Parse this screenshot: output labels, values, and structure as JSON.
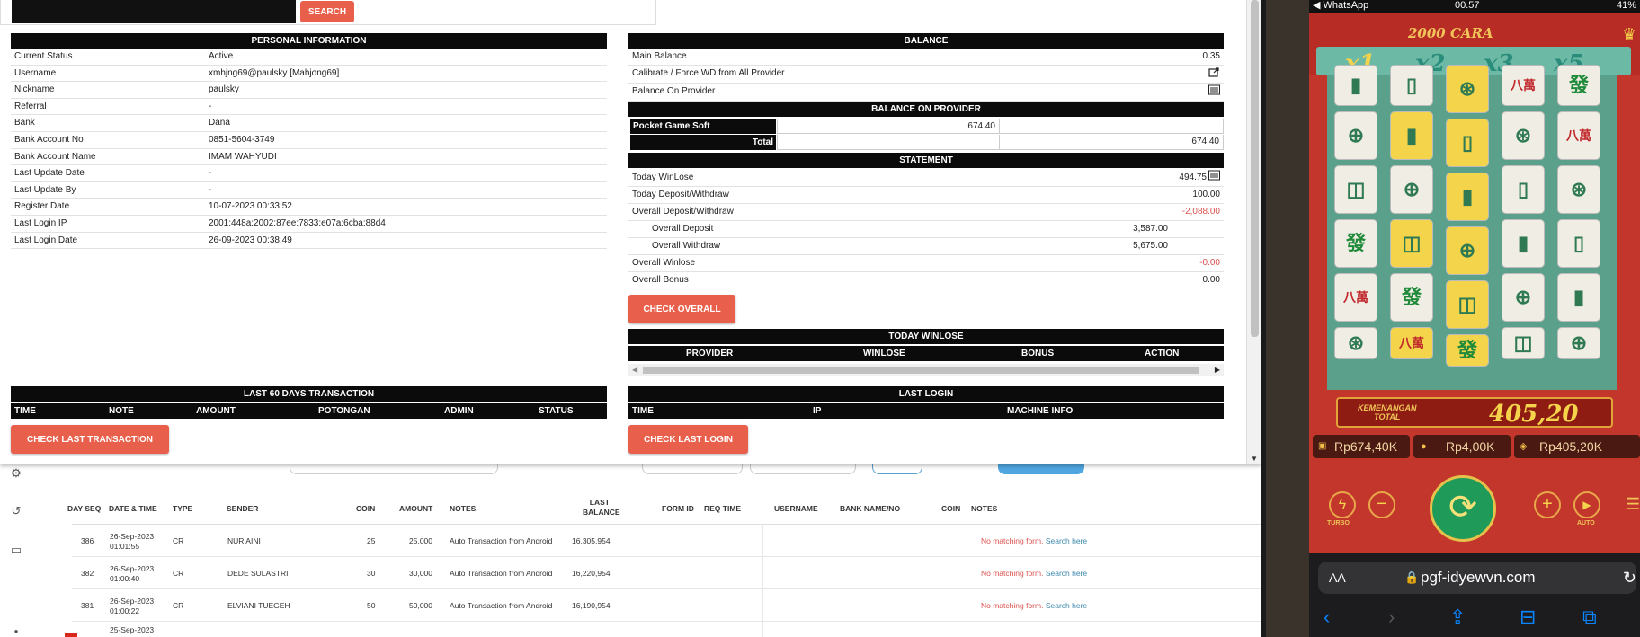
{
  "search": {
    "button_label": "SEARCH"
  },
  "personal": {
    "title": "PERSONAL INFORMATION",
    "rows": [
      {
        "label": "Current Status",
        "value": "Active"
      },
      {
        "label": "Username",
        "value": "xmhjng69@paulsky  [Mahjong69]"
      },
      {
        "label": "Nickname",
        "value": "paulsky"
      },
      {
        "label": "Referral",
        "value": "-"
      },
      {
        "label": "Bank",
        "value": "Dana"
      },
      {
        "label": "Bank Account No",
        "value": "0851-5604-3749"
      },
      {
        "label": "Bank Account Name",
        "value": "IMAM WAHYUDI"
      },
      {
        "label": "Last Update Date",
        "value": "-"
      },
      {
        "label": "Last Update By",
        "value": "-"
      },
      {
        "label": "Register Date",
        "value": "10-07-2023 00:33:52"
      },
      {
        "label": "Last Login IP",
        "value": "2001:448a:2002:87ee:7833:e07a:6cba:88d4"
      },
      {
        "label": "Last Login Date",
        "value": "26-09-2023 00:38:49"
      }
    ]
  },
  "balance": {
    "title": "BALANCE",
    "main_label": "Main Balance",
    "main_value": "0.35",
    "calibrate_label": "Calibrate / Force WD from All Provider",
    "on_provider_label": "Balance On Provider",
    "provider_title": "BALANCE ON PROVIDER",
    "provider_name": "Pocket Game Soft",
    "provider_value": "674.40",
    "total_label": "Total",
    "total_value": "674.40"
  },
  "statement": {
    "title": "STATEMENT",
    "today_winlose_label": "Today WinLose",
    "today_winlose_value": "494.75",
    "today_dw_label": "Today Deposit/Withdraw",
    "today_dw_value": "100.00",
    "overall_dw_label": "Overall Deposit/Withdraw",
    "overall_dw_value": "-2,088.00",
    "overall_deposit_label": "Overall Deposit",
    "overall_deposit_value": "3,587.00",
    "overall_withdraw_label": "Overall Withdraw",
    "overall_withdraw_value": "5,675.00",
    "overall_winlose_label": "Overall Winlose",
    "overall_winlose_value": "-0.00",
    "overall_bonus_label": "Overall Bonus",
    "overall_bonus_value": "0.00",
    "check_overall": "CHECK OVERALL"
  },
  "today_winlose": {
    "title": "TODAY WINLOSE",
    "columns": [
      "PROVIDER",
      "WINLOSE",
      "BONUS",
      "ACTION"
    ]
  },
  "last60": {
    "title": "LAST 60 DAYS TRANSACTION",
    "columns": [
      "TIME",
      "NOTE",
      "AMOUNT",
      "POTONGAN",
      "ADMIN",
      "STATUS"
    ],
    "button": "CHECK LAST TRANSACTION"
  },
  "last_login": {
    "title": "LAST LOGIN",
    "columns": [
      "TIME",
      "IP",
      "MACHINE INFO"
    ],
    "button": "CHECK LAST LOGIN"
  },
  "bg_table": {
    "headers": [
      "DAY SEQ",
      "DATE & TIME",
      "TYPE",
      "SENDER",
      "COIN",
      "AMOUNT",
      "NOTES",
      "LAST BALANCE",
      "FORM ID",
      "REQ TIME",
      "USERNAME",
      "BANK NAME/NO",
      "COIN",
      "NOTES"
    ],
    "rows": [
      {
        "seq": "386",
        "date": "26-Sep-2023 01:01:55",
        "type": "CR",
        "sender": "NUR AINI",
        "coin": "25",
        "amount": "25,000",
        "notes": "Auto Transaction from Android",
        "last": "16,305,954",
        "nomatch": "No matching form.",
        "search": "Search here"
      },
      {
        "seq": "382",
        "date": "26-Sep-2023 01:00:40",
        "type": "CR",
        "sender": "DEDE SULASTRI",
        "coin": "30",
        "amount": "30,000",
        "notes": "Auto Transaction from Android",
        "last": "16,220,954",
        "nomatch": "No matching form.",
        "search": "Search here"
      },
      {
        "seq": "381",
        "date": "26-Sep-2023 01:00:22",
        "type": "CR",
        "sender": "ELVIANI TUEGEH",
        "coin": "50",
        "amount": "50,000",
        "notes": "Auto Transaction from Android",
        "last": "16,190,954",
        "nomatch": "No matching form.",
        "search": "Search here"
      },
      {
        "seq": "",
        "date": "25-Sep-2023",
        "type": "",
        "sender": "",
        "coin": "",
        "amount": "",
        "notes": "",
        "last": "",
        "nomatch": "",
        "search": ""
      }
    ]
  },
  "phone": {
    "status_app": "◀ WhatsApp",
    "status_time": "00.57",
    "status_batt": "41%",
    "game_title": "2000 CARA",
    "multipliers": [
      "x1",
      "x2",
      "x3",
      "x5"
    ],
    "win_label_1": "KEMENANGAN",
    "win_label_2": "TOTAL",
    "win_value": "405,20",
    "stat_balance": "Rp674,40K",
    "stat_bet": "Rp4,00K",
    "stat_win": "Rp405,20K",
    "turbo": "TURBO",
    "auto": "AUTO",
    "url_aa": "AA",
    "url": "pgf-idyewvn.com"
  },
  "colors": {
    "accent": "#e8604c",
    "header": "#0b0b0b",
    "negative": "#d9534f",
    "link": "#3a87ad"
  }
}
